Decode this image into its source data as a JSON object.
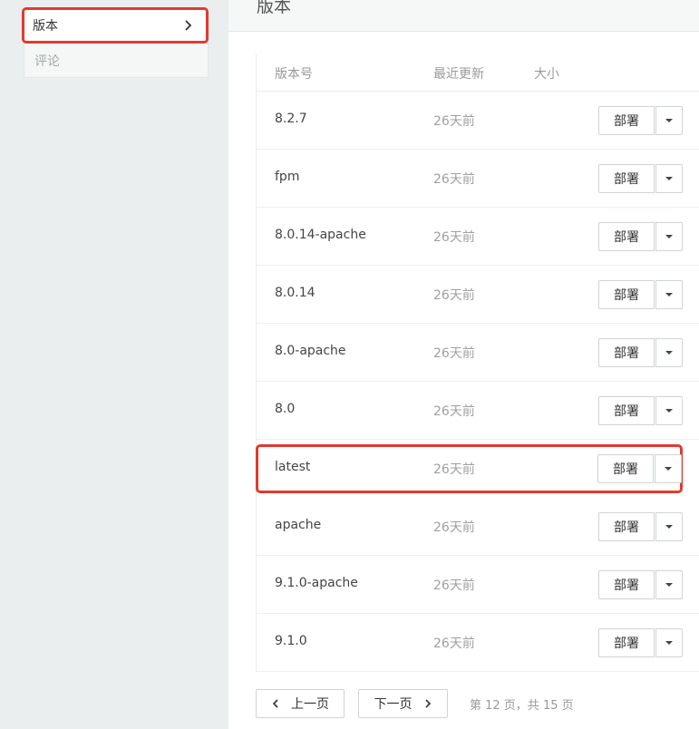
{
  "sidebar": {
    "items": [
      {
        "label": "版本",
        "active": true,
        "icon": "chevron-right-icon"
      },
      {
        "label": "评论",
        "active": false
      }
    ]
  },
  "header": {
    "title": "版本"
  },
  "table": {
    "columns": [
      "版本号",
      "最近更新",
      "大小"
    ],
    "rows": [
      {
        "version": "8.2.7",
        "updated": "26天前",
        "action": "部署"
      },
      {
        "version": "fpm",
        "updated": "26天前",
        "action": "部署"
      },
      {
        "version": "8.0.14-apache",
        "updated": "26天前",
        "action": "部署"
      },
      {
        "version": "8.0.14",
        "updated": "26天前",
        "action": "部署"
      },
      {
        "version": "8.0-apache",
        "updated": "26天前",
        "action": "部署"
      },
      {
        "version": "8.0",
        "updated": "26天前",
        "action": "部署"
      },
      {
        "version": "latest",
        "updated": "26天前",
        "action": "部署",
        "highlighted": true
      },
      {
        "version": "apache",
        "updated": "26天前",
        "action": "部署"
      },
      {
        "version": "9.1.0-apache",
        "updated": "26天前",
        "action": "部署"
      },
      {
        "version": "9.1.0",
        "updated": "26天前",
        "action": "部署"
      }
    ]
  },
  "pagination": {
    "prev_label": "上一页",
    "next_label": "下一页",
    "info": "第 12 页，共 15 页"
  },
  "colors": {
    "highlight": "#e23a2f",
    "background": "#eaeeee"
  }
}
